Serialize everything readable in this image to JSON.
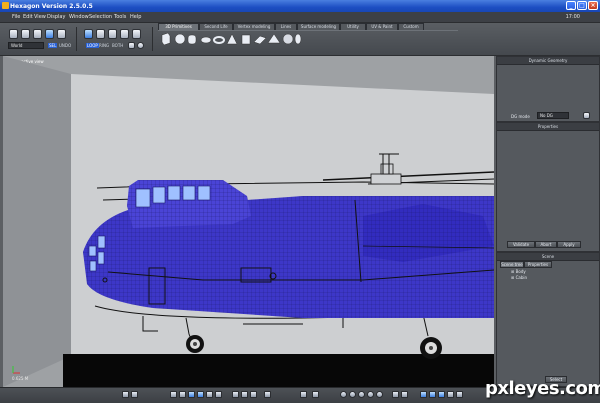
{
  "window": {
    "title": "Hexagon Version 2.5.0.5",
    "min": "_",
    "max": "□",
    "close": "×"
  },
  "menu": [
    "File",
    "Edit",
    "View",
    "Display",
    "Window",
    "Selection",
    "Tools",
    "Help"
  ],
  "clock": "17:00",
  "toolbar": {
    "world_option": "World",
    "select_labels": [
      "SEL",
      "UNDO"
    ],
    "loop_labels": [
      "LOOP",
      "RING",
      "BOTH"
    ],
    "tabs": [
      "3D Primitives",
      "Second Life",
      "Vertex modeling",
      "Lines",
      "Surface modeling",
      "Utility",
      "UV & Paint",
      "Custom"
    ],
    "active_tab": "3D Primitives"
  },
  "viewport": {
    "label": "Perspective view",
    "axis_readout": "0.625 M"
  },
  "panels": {
    "dynamic_geometry": {
      "title": "Dynamic Geometry",
      "dg_mode_label": "DG mode",
      "dg_mode_value": "No DG"
    },
    "properties": {
      "title": "Properties",
      "buttons": [
        "Validate",
        "Abort",
        "Apply"
      ]
    },
    "scene": {
      "title": "Scene",
      "tabs": [
        "Scene tree",
        "Properties"
      ],
      "items": [
        "Body",
        "Cabin"
      ],
      "footer_button": "Select"
    }
  },
  "watermark": "pxleyes.com",
  "colors": {
    "titlebar": "#2457cf",
    "mesh": "#3b36c9",
    "viewport_bg": "#9ea1a4"
  }
}
